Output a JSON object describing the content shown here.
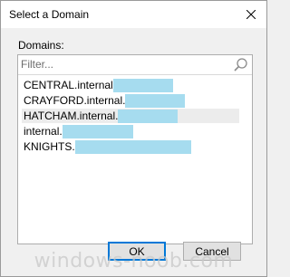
{
  "dialog": {
    "title": "Select a Domain"
  },
  "domains_label": "Domains:",
  "filter": {
    "placeholder": "Filter..."
  },
  "domains": [
    {
      "label": "CENTRAL.internal"
    },
    {
      "label": "CRAYFORD.internal."
    },
    {
      "label": "HATCHAM.internal."
    },
    {
      "label": "internal."
    },
    {
      "label": "KNIGHTS."
    }
  ],
  "buttons": {
    "ok": "OK",
    "cancel": "Cancel"
  },
  "watermark": "windows-noob.com",
  "colors": {
    "redaction": "#a6dcef",
    "focus_border": "#0078d7"
  },
  "icons": {
    "close": "close-icon",
    "search": "search-icon"
  }
}
